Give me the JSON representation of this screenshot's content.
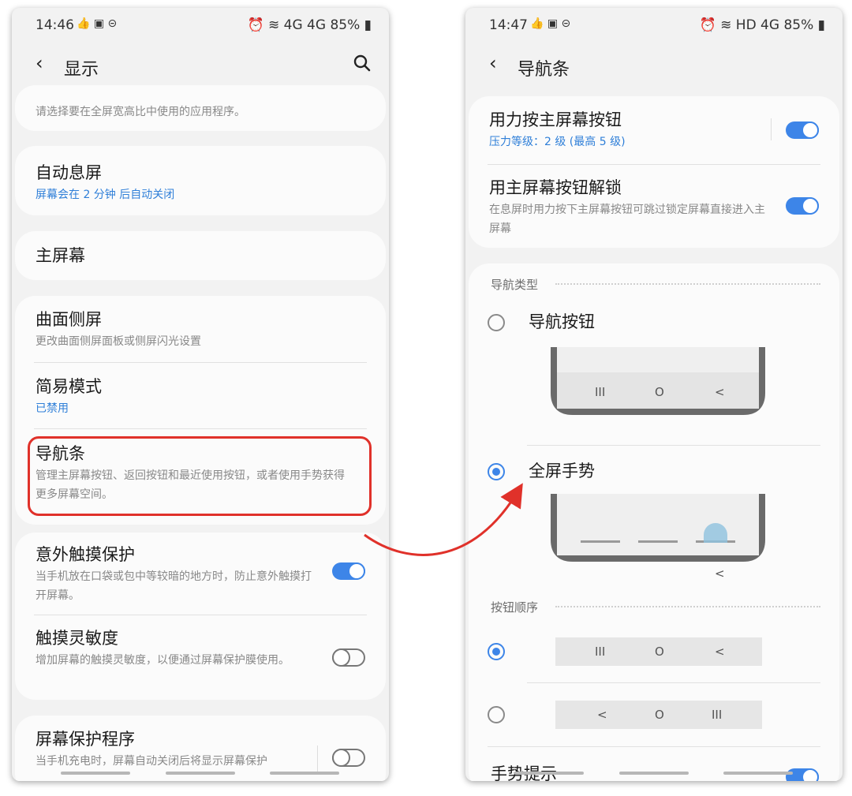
{
  "status_left": {
    "time": "14:46",
    "icons": "👍 ▣ ⊝",
    "right": "⏰ ≋ 4G 4G 85% ▮"
  },
  "status_right": {
    "time": "14:47",
    "icons": "👍 ▣ ⊝",
    "right": "⏰ ≋ HD 4G 85% ▮"
  },
  "left": {
    "title": "显示",
    "cut_item": {
      "subtitle": "请选择要在全屏宽高比中使用的应用程序。"
    },
    "screen_timeout": {
      "title": "自动息屏",
      "subtitle": "屏幕会在 2 分钟 后自动关闭"
    },
    "home_screen": {
      "title": "主屏幕"
    },
    "edge_screen": {
      "title": "曲面侧屏",
      "subtitle": "更改曲面侧屏面板或侧屏闪光设置"
    },
    "easy_mode": {
      "title": "简易模式",
      "subtitle": "已禁用"
    },
    "navigation_bar": {
      "title": "导航条",
      "subtitle": "管理主屏幕按钮、返回按钮和最近使用按钮，或者使用手势获得更多屏幕空间。"
    },
    "accidental_touch": {
      "title": "意外触摸保护",
      "subtitle": "当手机放在口袋或包中等较暗的地方时，防止意外触摸打开屏幕。",
      "enabled": true
    },
    "touch_sensitivity": {
      "title": "触摸灵敏度",
      "subtitle": "增加屏幕的触摸灵敏度，以便通过屏幕保护膜使用。",
      "enabled": false
    },
    "screensaver": {
      "title": "屏幕保护程序",
      "subtitle": "当手机充电时，屏幕自动关闭后将显示屏幕保护",
      "enabled": false
    }
  },
  "right": {
    "title": "导航条",
    "press_home": {
      "title": "用力按主屏幕按钮",
      "subtitle": "压力等级：2 级 (最高 5 级)",
      "enabled": true
    },
    "unlock_home": {
      "title": "用主屏幕按钮解锁",
      "subtitle": "在息屏时用力按下主屏幕按钮可跳过锁定屏幕直接进入主屏幕",
      "enabled": true
    },
    "nav_type_section": "导航类型",
    "nav_buttons": {
      "label": "导航按钮",
      "selected": false,
      "icons": [
        "III",
        "O",
        "<"
      ]
    },
    "full_gestures": {
      "label": "全屏手势",
      "selected": true,
      "back_icon": "<"
    },
    "button_order_section": "按钮顺序",
    "order_1": {
      "selected": true,
      "icons": [
        "III",
        "O",
        "<"
      ]
    },
    "order_2": {
      "selected": false,
      "icons": [
        "<",
        "O",
        "III"
      ]
    },
    "gesture_hint": {
      "title": "手势提示",
      "enabled": true
    }
  }
}
